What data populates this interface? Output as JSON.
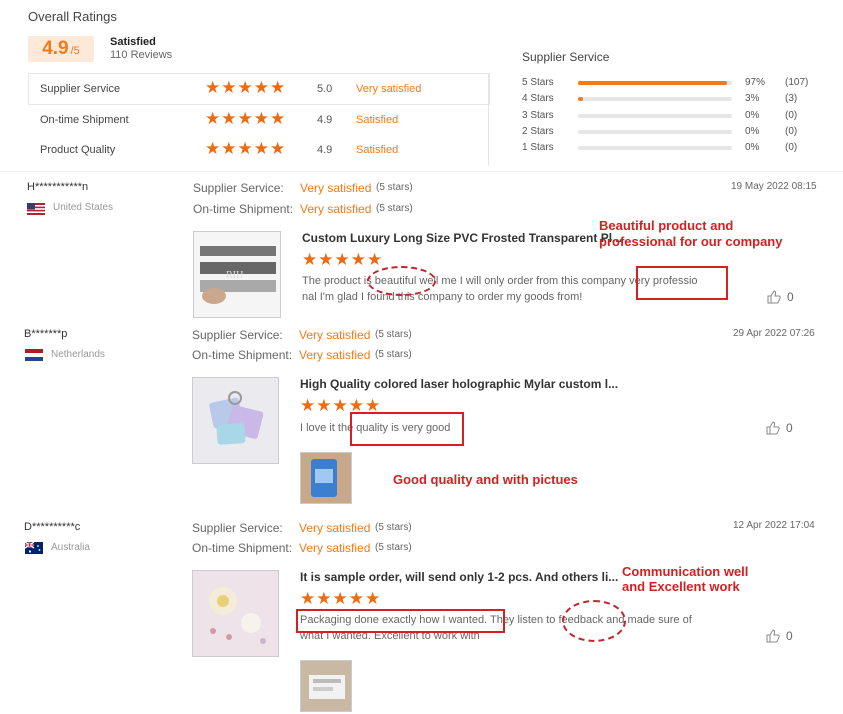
{
  "overall": {
    "title": "Overall Ratings",
    "score": "4.9",
    "score_suffix": "/5",
    "label": "Satisfied",
    "reviews": "110 Reviews"
  },
  "categories": [
    {
      "name": "Supplier Service",
      "score": "5.0",
      "status": "Very satisfied"
    },
    {
      "name": "On-time Shipment",
      "score": "4.9",
      "status": "Satisfied"
    },
    {
      "name": "Product Quality",
      "score": "4.9",
      "status": "Satisfied"
    }
  ],
  "distribution": {
    "title": "Supplier Service",
    "rows": [
      {
        "label": "5 Stars",
        "fill": 0.97,
        "pct": "97%",
        "count": "(107)"
      },
      {
        "label": "4 Stars",
        "fill": 0.03,
        "pct": "3%",
        "count": "(3)"
      },
      {
        "label": "3 Stars",
        "fill": 0,
        "pct": "0%",
        "count": "(0)"
      },
      {
        "label": "2 Stars",
        "fill": 0,
        "pct": "0%",
        "count": "(0)"
      },
      {
        "label": "1 Stars",
        "fill": 0,
        "pct": "0%",
        "count": "(0)"
      }
    ]
  },
  "reviews": [
    {
      "user": "H***********n",
      "country": "United States",
      "flag": "flag-us-icon",
      "date": "19 May 2022 08:15",
      "service_label": "Supplier Service:",
      "service_value": "Very satisfied",
      "service_stars": "(5 stars)",
      "shipment_label": "On-time Shipment:",
      "shipment_value": "Very satisfied",
      "shipment_stars": "(5 stars)",
      "product": "Custom Luxury Long Size PVC Frosted Transparent Pl...",
      "text1": "The product is beautiful well me I will only order from this company very professio",
      "text2": "nal I'm glad I found this company to order my goods from!",
      "likes": "0",
      "note": "Beautiful product and\nprofessional for our company"
    },
    {
      "user": "B*******p",
      "country": "Netherlands",
      "flag": "flag-nl-icon",
      "date": "29 Apr 2022 07:26",
      "service_label": "Supplier Service:",
      "service_value": "Very satisfied",
      "service_stars": "(5 stars)",
      "shipment_label": "On-time Shipment:",
      "shipment_value": "Very satisfied",
      "shipment_stars": "(5 stars)",
      "product": "High Quality colored laser holographic Mylar custom l...",
      "text1": "I love it the quality is very good",
      "likes": "0",
      "note": "Good quality and with pictues"
    },
    {
      "user": "D**********c",
      "country": "Australia",
      "flag": "flag-au-icon",
      "date": "12 Apr 2022 17:04",
      "service_label": "Supplier Service:",
      "service_value": "Very satisfied",
      "service_stars": "(5 stars)",
      "shipment_label": "On-time Shipment:",
      "shipment_value": "Very satisfied",
      "shipment_stars": "(5 stars)",
      "product": "It is sample order, will send only 1-2 pcs. And others li...",
      "text1": "Packaging done exactly how I wanted. They listen to feedback and made sure of",
      "text2": "what I wanted. Excellent to work with",
      "likes": "0",
      "note": "Communication well\nand Excellent work"
    }
  ],
  "colors": {
    "accent": "#f27a1a",
    "annotation": "#d42020"
  }
}
